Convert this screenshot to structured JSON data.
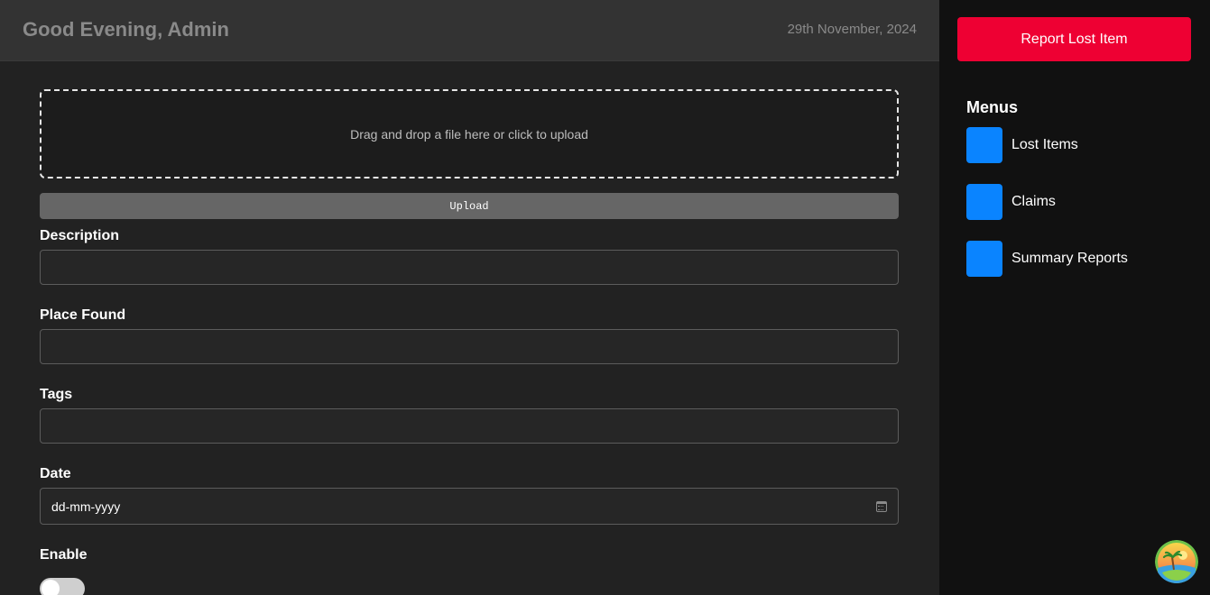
{
  "header": {
    "greeting": "Good Evening, Admin",
    "date": "29th November, 2024"
  },
  "upload": {
    "dropzone_text": "Drag and drop a file here or click to upload",
    "button_label": "Upload"
  },
  "form": {
    "description_label": "Description",
    "description_value": "",
    "place_found_label": "Place Found",
    "place_found_value": "",
    "tags_label": "Tags",
    "tags_value": "",
    "date_label": "Date",
    "date_placeholder": "dd-mm-yyyy",
    "enable_label": "Enable",
    "enable_on": false
  },
  "sidebar": {
    "report_button": "Report Lost Item",
    "menus_heading": "Menus",
    "items": [
      {
        "label": "Lost Items",
        "icon": "lost-items-icon"
      },
      {
        "label": "Claims",
        "icon": "claims-icon"
      },
      {
        "label": "Summary Reports",
        "icon": "summary-reports-icon"
      }
    ]
  },
  "colors": {
    "accent_red": "#ee0033",
    "menu_icon_blue": "#0a84ff",
    "main_bg": "#222222",
    "sidebar_bg": "#111111",
    "header_bg": "#333333"
  }
}
